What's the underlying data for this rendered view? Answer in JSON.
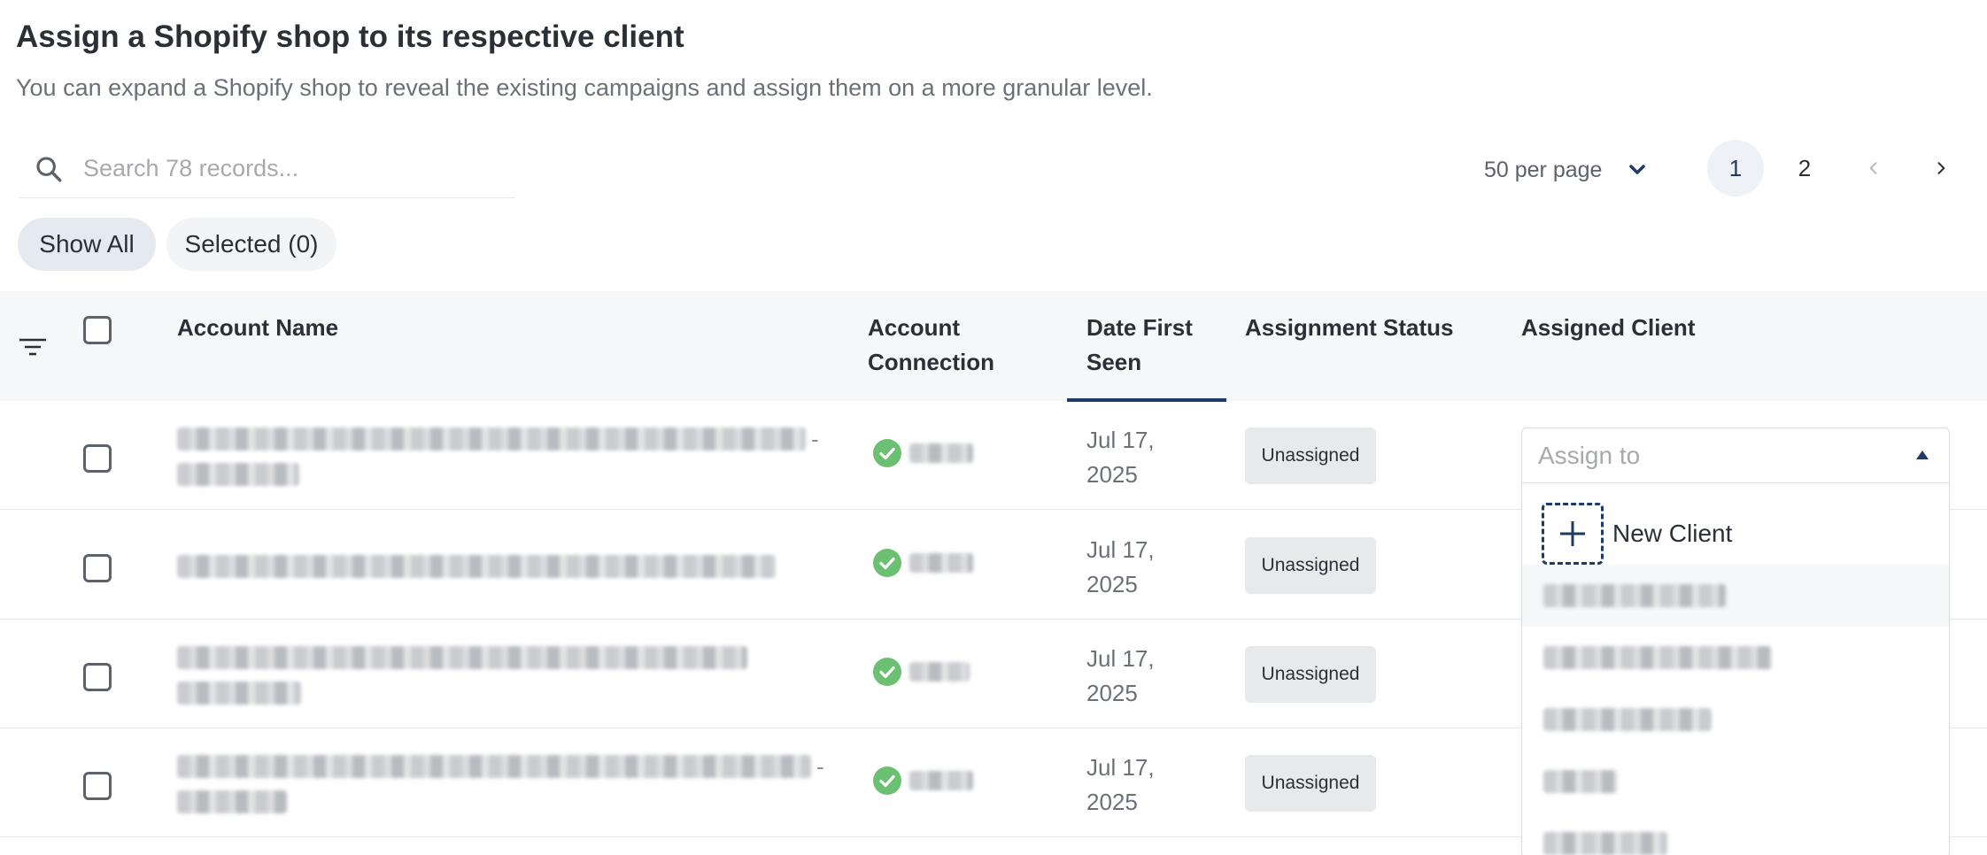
{
  "header": {
    "title": "Assign a Shopify shop to its respective client",
    "subtitle": "You can expand a Shopify shop to reveal the existing campaigns and assign them on a more granular level."
  },
  "search": {
    "placeholder": "Search 78 records..."
  },
  "pagination": {
    "per_page_label": "50 per page",
    "pages": [
      "1",
      "2"
    ],
    "current_page": "1"
  },
  "filters": {
    "show_all": "Show All",
    "selected": "Selected (0)"
  },
  "table": {
    "columns": {
      "account_name": "Account Name",
      "account_connection_line1": "Account",
      "account_connection_line2": "Connection",
      "date_first_seen_line1": "Date First",
      "date_first_seen_line2": "Seen",
      "assignment_status": "Assignment Status",
      "assigned_client": "Assigned Client"
    },
    "rows": [
      {
        "date_line1": "Jul 17,",
        "date_line2": "2025",
        "status": "Unassigned",
        "has_dash": "-"
      },
      {
        "date_line1": "Jul 17,",
        "date_line2": "2025",
        "status": "Unassigned",
        "has_dash": ""
      },
      {
        "date_line1": "Jul 17,",
        "date_line2": "2025",
        "status": "Unassigned",
        "has_dash": ""
      },
      {
        "date_line1": "Jul 17,",
        "date_line2": "2025",
        "status": "Unassigned",
        "has_dash": "-"
      }
    ]
  },
  "assign_dropdown": {
    "placeholder": "Assign to",
    "new_client_label": "New Client"
  },
  "colors": {
    "accent": "#1d3b66",
    "success": "#6cc071",
    "badge_bg": "#e8e9eb",
    "header_bg": "#f6f7f8"
  }
}
